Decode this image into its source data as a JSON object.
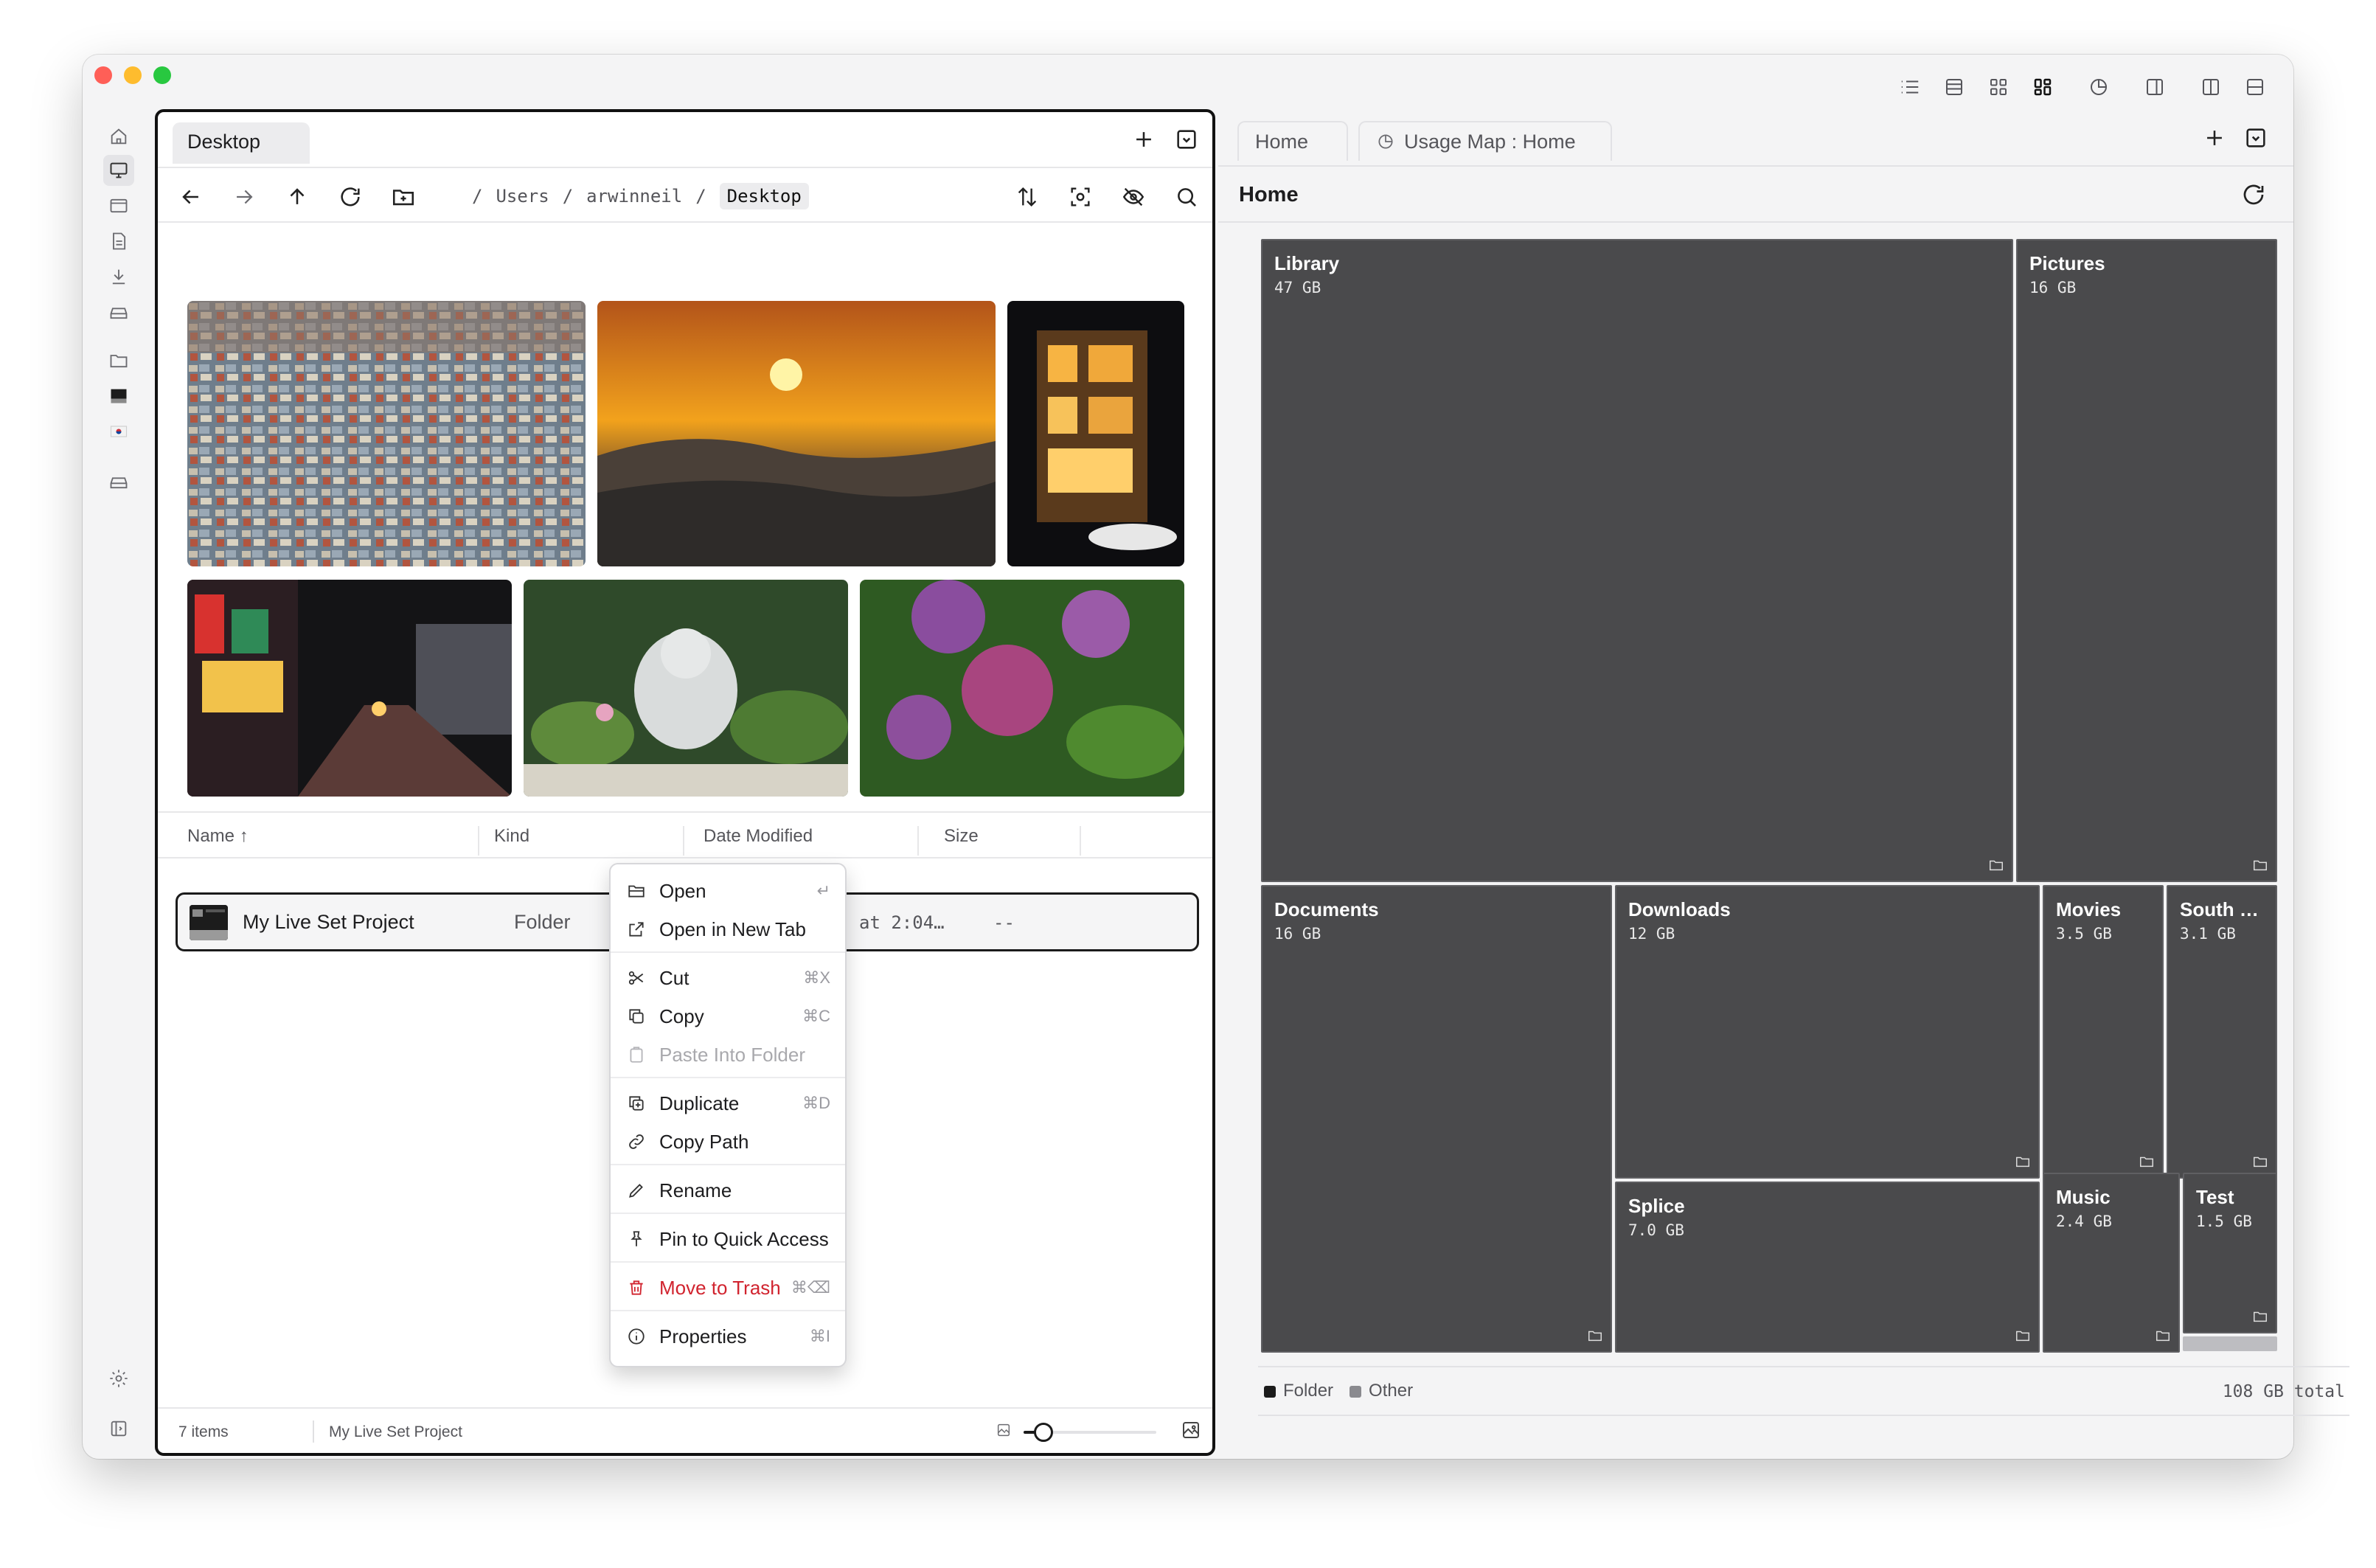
{
  "left_pane": {
    "tab_title": "Desktop",
    "breadcrumbs": [
      "Users",
      "arwinneil",
      "Desktop"
    ],
    "columns": {
      "name": "Name",
      "kind": "Kind",
      "date": "Date Modified",
      "size": "Size"
    },
    "selected_file": {
      "name": "My Live Set Project",
      "kind": "Folder",
      "date": "at 2:04…",
      "size": "--"
    },
    "status": {
      "count": "7 items",
      "selection": "My Live Set Project",
      "zoom_level": 0.15
    }
  },
  "context_menu": {
    "items": [
      {
        "label": "Open",
        "shortcut": "↵",
        "icon": "folder-open-icon"
      },
      {
        "label": "Open in New Tab",
        "shortcut": "",
        "icon": "external-link-icon"
      },
      {
        "label": "Cut",
        "shortcut": "⌘X",
        "icon": "scissors-icon"
      },
      {
        "label": "Copy",
        "shortcut": "⌘C",
        "icon": "copy-icon"
      },
      {
        "label": "Paste Into Folder",
        "shortcut": "",
        "icon": "clipboard-icon",
        "disabled": true
      },
      {
        "label": "Duplicate",
        "shortcut": "⌘D",
        "icon": "duplicate-icon"
      },
      {
        "label": "Copy Path",
        "shortcut": "",
        "icon": "link-icon"
      },
      {
        "label": "Rename",
        "shortcut": "",
        "icon": "pencil-icon"
      },
      {
        "label": "Pin to Quick Access",
        "shortcut": "",
        "icon": "pin-icon"
      },
      {
        "label": "Move to Trash",
        "shortcut": "⌘⌫",
        "icon": "trash-icon",
        "danger": true
      },
      {
        "label": "Properties",
        "shortcut": "⌘I",
        "icon": "info-icon"
      }
    ]
  },
  "right_pane": {
    "tabs": [
      "Home",
      "Usage Map : Home"
    ],
    "header_title": "Home",
    "treemap": [
      {
        "name": "Library",
        "size": "47 GB"
      },
      {
        "name": "Pictures",
        "size": "16 GB"
      },
      {
        "name": "Documents",
        "size": "16 GB"
      },
      {
        "name": "Downloads",
        "size": "12 GB"
      },
      {
        "name": "Movies",
        "size": "3.5 GB"
      },
      {
        "name": "South …",
        "size": "3.1 GB"
      },
      {
        "name": "Splice",
        "size": "7.0 GB"
      },
      {
        "name": "Music",
        "size": "2.4 GB"
      },
      {
        "name": "Test",
        "size": "1.5 GB"
      }
    ],
    "legend": {
      "folder": "Folder",
      "other": "Other"
    },
    "total": "108 GB total"
  },
  "colors": {
    "tile_fill": "#4a4a4c",
    "danger": "#d1242f",
    "accent_dark": "#1b1b1b"
  }
}
